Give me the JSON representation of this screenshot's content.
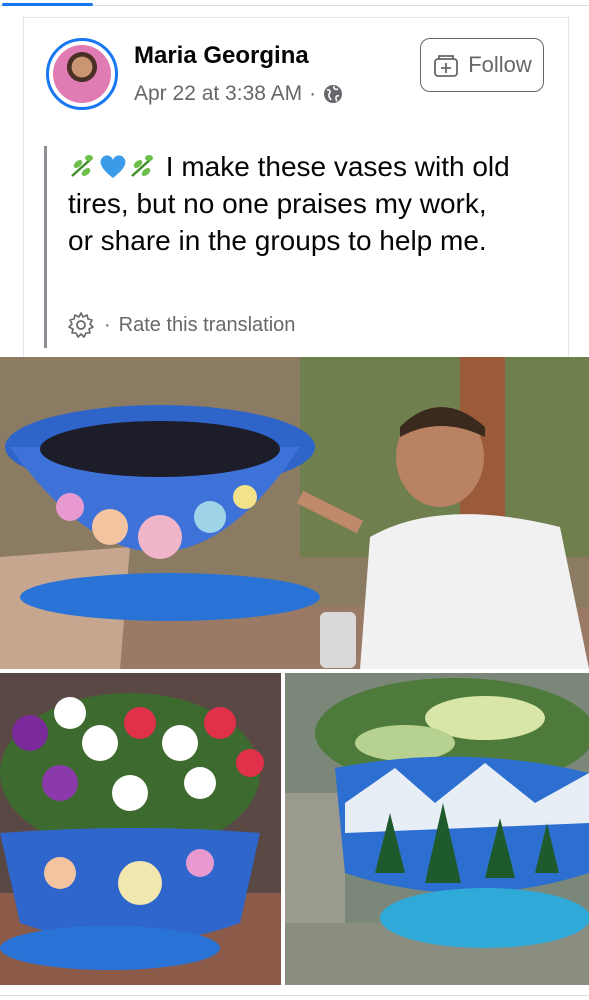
{
  "post": {
    "author": "Maria Georgina",
    "timestamp": "Apr 22 at 3:38 AM",
    "separator": "·",
    "audience_icon": "globe-icon",
    "follow_label": "Follow",
    "text_emojis": [
      "herb",
      "blue-heart",
      "herb"
    ],
    "text": "I make these vases with old tires, but no one praises my work, or share in the groups to help me.",
    "translation_dot": "·",
    "translation_link": "Rate this translation"
  },
  "colors": {
    "accent": "#1877f2",
    "secondary_text": "#65676b",
    "primary_text": "#050505"
  },
  "photos": [
    {
      "icon": "photo-man-painting-tire-vase"
    },
    {
      "icon": "photo-petunia-tire-planter"
    },
    {
      "icon": "photo-mountain-scene-tire-planter"
    }
  ]
}
